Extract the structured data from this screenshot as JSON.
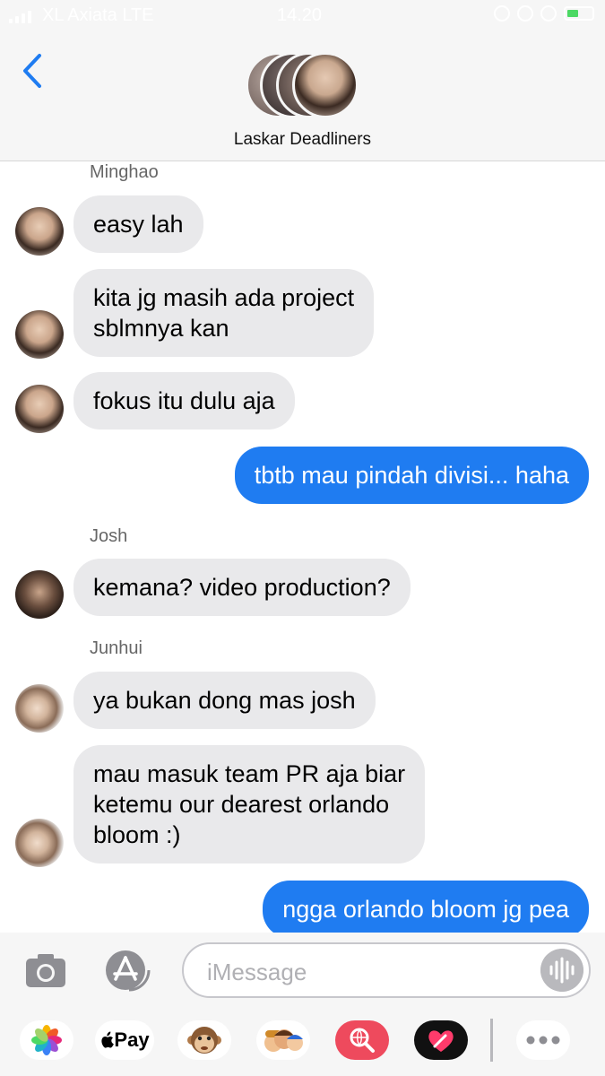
{
  "status_bar": {
    "carrier": "XL Axiata LTE",
    "time": "14.20"
  },
  "header": {
    "group_name": "Laskar Deadliners"
  },
  "messages": [
    {
      "sender": "Minghao",
      "text": "easy lah"
    },
    {
      "text_line1": "kita jg masih ada project",
      "text_line2": "sblmnya kan"
    },
    {
      "text": "fokus itu dulu aja"
    },
    {
      "text": "tbtb mau pindah divisi... haha"
    },
    {
      "sender": "Josh",
      "text": "kemana? video production?"
    },
    {
      "sender": "Junhui",
      "text": "ya bukan dong mas josh"
    },
    {
      "text_line1": "mau masuk team PR aja biar",
      "text_line2": "ketemu our dearest orlando",
      "text_line3": "bloom :)"
    },
    {
      "text": "ngga orlando bloom jg pea"
    }
  ],
  "composer": {
    "placeholder": "iMessage",
    "apple_pay_label": "Pay"
  },
  "colors": {
    "outgoing_bubble": "#1f7cf1",
    "incoming_bubble": "#e9e9eb",
    "accent": "#1f7cf1"
  },
  "icons": [
    "back-chevron-icon",
    "camera-icon",
    "app-store-icon",
    "audio-waveform-icon",
    "photos-icon",
    "apple-pay-icon",
    "animoji-monkey-icon",
    "memoji-icon",
    "image-search-icon",
    "digital-touch-icon",
    "more-icon"
  ]
}
